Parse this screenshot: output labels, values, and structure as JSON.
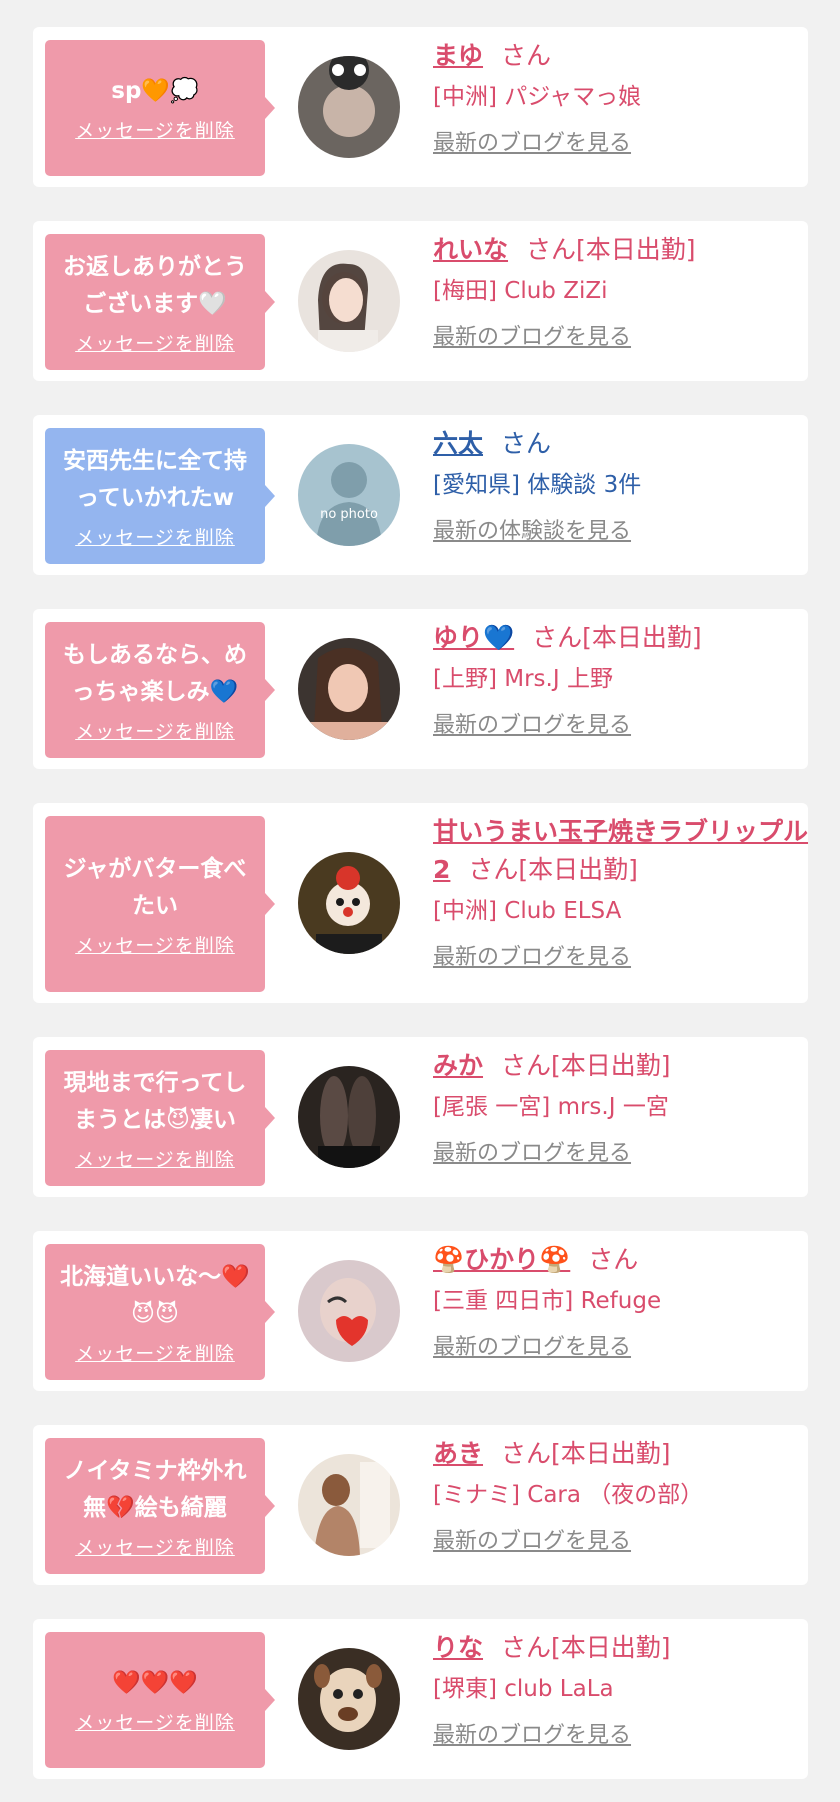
{
  "common": {
    "delete_label": "メッセージを削除"
  },
  "entries": [
    {
      "message": "sp🧡💭",
      "name": "まゆ",
      "suffix": "さん",
      "shop": "[中洲] パジャマっ娘",
      "blog": "最新のブログを見る",
      "theme": "pink"
    },
    {
      "message": "お返しありがとうございます🤍",
      "name": "れいな",
      "suffix": "さん[本日出勤]",
      "shop": "[梅田] Club ZiZi",
      "blog": "最新のブログを見る",
      "theme": "pink"
    },
    {
      "message": "安西先生に全て持っていかれたw",
      "name": "六太",
      "suffix": "さん",
      "shop": "[愛知県] 体験談 3件",
      "blog": "最新の体験談を見る",
      "theme": "blue",
      "avatar_text": "no photo"
    },
    {
      "message": "もしあるなら、めっちゃ楽しみ💙",
      "name": "ゆり💙",
      "suffix": "さん[本日出勤]",
      "shop": "[上野] Mrs.J 上野",
      "blog": "最新のブログを見る",
      "theme": "pink"
    },
    {
      "message": "ジャがバター食べたい",
      "name": "甘いうまい玉子焼きラブリップル2",
      "suffix": "さん[本日出勤]",
      "shop": "[中洲] Club ELSA",
      "blog": "最新のブログを見る",
      "theme": "pink"
    },
    {
      "message": "現地まで行ってしまうとは😈凄い",
      "name": "みか",
      "suffix": "さん[本日出勤]",
      "shop": "[尾張 一宮] mrs.J 一宮",
      "blog": "最新のブログを見る",
      "theme": "pink"
    },
    {
      "message": "北海道いいな〜❤️😈😈",
      "name": "🍄ひかり🍄",
      "suffix": "さん",
      "shop": "[三重 四日市] Refuge",
      "blog": "最新のブログを見る",
      "theme": "pink"
    },
    {
      "message": "ノイタミナ枠外れ無💔絵も綺麗",
      "name": "あき",
      "suffix": "さん[本日出勤]",
      "shop": "[ミナミ] Cara （夜の部）",
      "blog": "最新のブログを見る",
      "theme": "pink"
    },
    {
      "message": "❤️❤️❤️",
      "name": "りな",
      "suffix": "さん[本日出勤]",
      "shop": "[堺東] club LaLa",
      "blog": "最新のブログを見る",
      "theme": "pink"
    }
  ],
  "colors": {
    "pink_text": "#d94c6c",
    "blue_text": "#2e5fa8",
    "pink_bubble": "#ef9aaa",
    "blue_bubble": "#94b5ef",
    "background": "#f1f1f1"
  }
}
